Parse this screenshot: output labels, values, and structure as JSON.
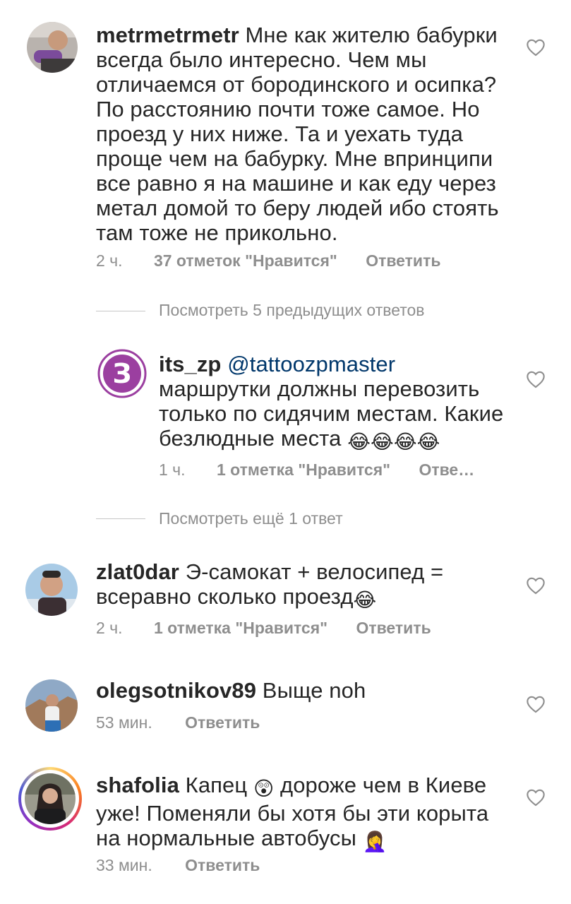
{
  "comments": [
    {
      "username": "metrmetrmetr",
      "text": "Мне как жителю бабурки всегда было интересно. Чем мы отличаемся от бородинского и осипка? По расстоянию почти тоже самое. Но проезд у них ниже. Та и уехать туда проще чем на бабурку. Мне впринципи все равно я на машине и как еду через метал домой то беру людей ибо стоять там тоже не прикольно.",
      "time": "2 ч.",
      "likes": "37 отметок \"Нравится\"",
      "reply": "Ответить"
    },
    {
      "view_previous": "Посмотреть 5 предыдущих ответов"
    },
    {
      "username": "its_zp",
      "mention": "@tattoozpmaster",
      "text": "маршрутки должны перевозить только по сидячим местам. Какие безлюдные места",
      "emoji": "😂😂😂😂",
      "time": "1 ч.",
      "likes": "1 отметка \"Нравится\"",
      "reply": "Отве…"
    },
    {
      "view_more": "Посмотреть ещё 1 ответ"
    },
    {
      "username": "zlat0dar",
      "text": "Э-самокат + велосипед = всеравно сколько проезд",
      "emoji": "😂",
      "time": "2 ч.",
      "likes": "1 отметка \"Нравится\"",
      "reply": "Ответить"
    },
    {
      "username": "olegsotnikov89",
      "text": "Выще noh",
      "time": "53 мин.",
      "reply": "Ответить"
    },
    {
      "username": "shafolia",
      "text_a": "Капец",
      "emoji_a": "😲",
      "text_b": "дороже чем в Киеве уже! Поменяли бы хотя бы эти корыта на нормальные автобусы",
      "emoji_b": "🤦‍♀️",
      "time": "33 мин.",
      "reply": "Ответить"
    }
  ],
  "colors": {
    "text": "#262626",
    "secondary": "#8e8e8e",
    "mention": "#00376b",
    "story_ring": "gradient"
  }
}
